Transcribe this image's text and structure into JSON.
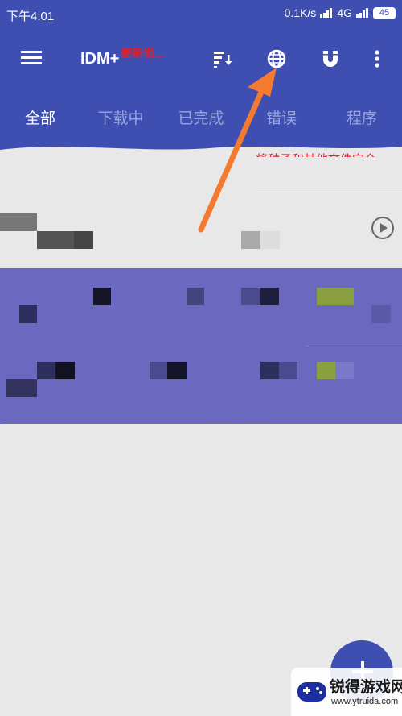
{
  "status_bar": {
    "time": "下午4:01",
    "net_speed": "0.1K/s",
    "network": "4G",
    "battery": "45"
  },
  "toolbar": {
    "title": "IDM+",
    "update_badge": "更新啦...",
    "icons": [
      "menu-icon",
      "sort-icon",
      "browser-globe-icon",
      "magnet-icon",
      "more-vert-icon"
    ]
  },
  "tabs": [
    {
      "label": "全部",
      "active": true
    },
    {
      "label": "下载中",
      "active": false
    },
    {
      "label": "已完成",
      "active": false
    },
    {
      "label": "错误",
      "active": false
    },
    {
      "label": "程序",
      "active": false
    }
  ],
  "annotation": {
    "hint_text": "将种子和其他文件完全"
  },
  "watermark": {
    "title": "锐得游戏网",
    "url": "www.ytruida.com"
  },
  "colors": {
    "primary": "#3e4fb1",
    "tab_inactive": "#9aa4dc",
    "arrow": "#f47a30",
    "annotation_red": "#e0202a",
    "overlay": "#6b68c0"
  }
}
